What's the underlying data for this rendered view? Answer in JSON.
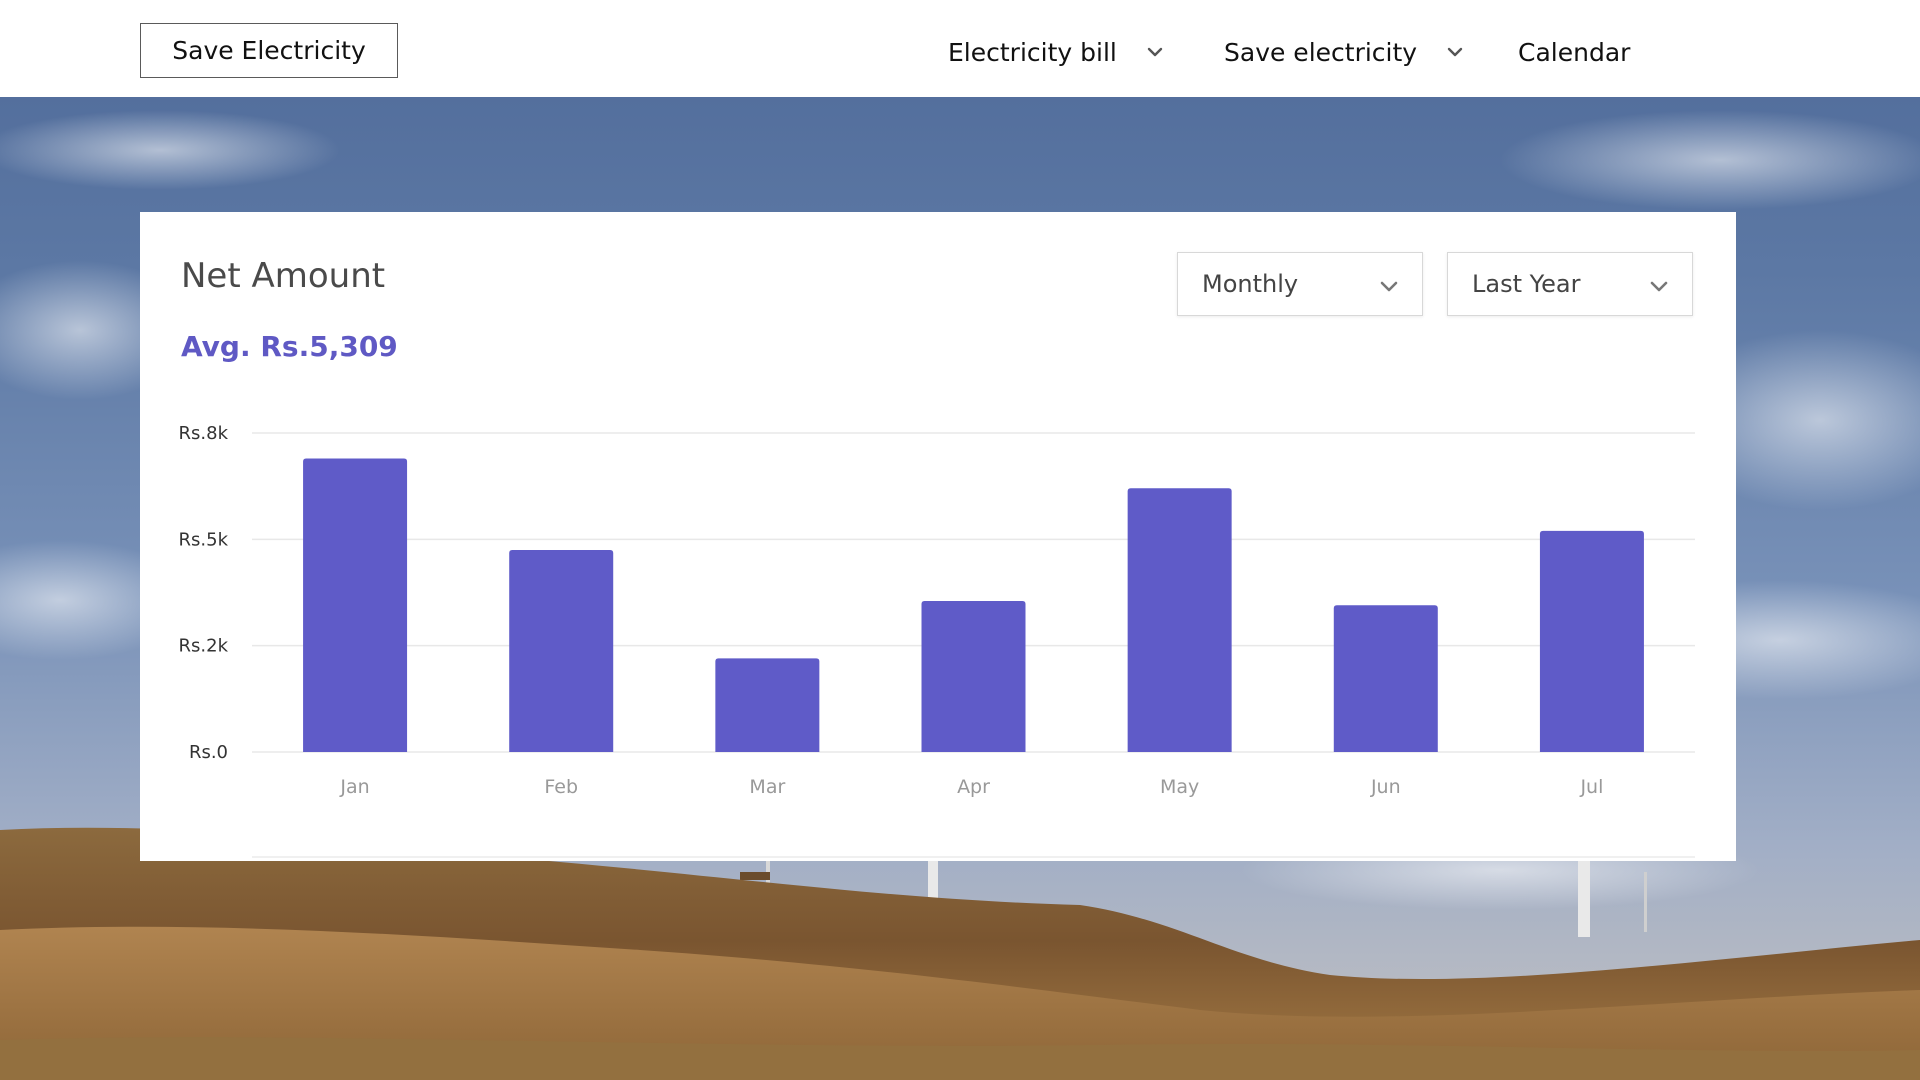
{
  "header": {
    "brand_label": "Save Electricity",
    "nav": [
      {
        "label": "Electricity bill",
        "icon": "chevron-down-icon"
      },
      {
        "label": "Save electricity",
        "icon": "chevron-down-icon"
      },
      {
        "label": "Calendar"
      }
    ]
  },
  "card": {
    "title": "Net Amount",
    "average": "Avg. Rs.5,309",
    "period_select": {
      "value": "Monthly",
      "icon": "chevron-down-icon"
    },
    "range_select": {
      "value": "Last Year",
      "icon": "chevron-down-icon"
    }
  },
  "colors": {
    "accent": "#5f5bc8",
    "average_text": "#5f59c4",
    "gridline": "#e8e8e8"
  },
  "chart_data": {
    "type": "bar",
    "categories": [
      "Jan",
      "Feb",
      "Mar",
      "Apr",
      "May",
      "Jun",
      "Jul"
    ],
    "values": [
      6900,
      4750,
      2200,
      3550,
      6200,
      3450,
      5200
    ],
    "ylim": [
      0,
      7500
    ],
    "yticks": [
      {
        "value": 0,
        "label": "Rs.0"
      },
      {
        "value": 2500,
        "label": "Rs.2k"
      },
      {
        "value": 5000,
        "label": "Rs.5k"
      },
      {
        "value": 7500,
        "label": "Rs.8k"
      }
    ],
    "grid": true
  }
}
